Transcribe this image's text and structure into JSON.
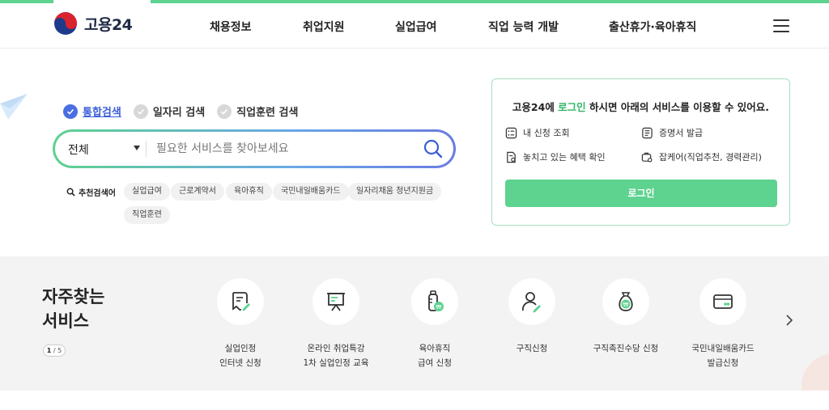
{
  "brand": {
    "name": "고용24"
  },
  "nav": {
    "items": [
      "채용정보",
      "취업지원",
      "실업급여",
      "직업 능력 개발",
      "출산휴가·육아휴직"
    ]
  },
  "search": {
    "tabs": [
      {
        "label": "통합검색",
        "active": true
      },
      {
        "label": "일자리 검색",
        "active": false
      },
      {
        "label": "직업훈련 검색",
        "active": false
      }
    ],
    "scope": "전체",
    "placeholder": "필요한 서비스를 찾아보세요",
    "value": "",
    "recommended_label": "추천검색어",
    "recommended": [
      "실업급여",
      "근로계약서",
      "육아휴직",
      "국민내일배움카드",
      "일자리채움 청년지원금",
      "직업훈련"
    ]
  },
  "login_card": {
    "msg_prefix": "고용24에 ",
    "msg_highlight": "로그인",
    "msg_suffix": " 하시면 아래의 서비스를 이용할 수 있어요.",
    "services": [
      "내 신청 조회",
      "증명서 발급",
      "놓치고 있는 혜택 확인",
      "잡케어(직업추천, 경력관리)"
    ],
    "button": "로그인"
  },
  "frequent": {
    "title_line1": "자주찾는",
    "title_line2": "서비스",
    "page_current": "1",
    "page_total": "/ 5",
    "items": [
      {
        "line1": "실업인정",
        "line2": "인터넷 신청",
        "icon": "document-pen-icon"
      },
      {
        "line1": "온라인 취업특강",
        "line2": "1차 실업인정 교육",
        "icon": "presentation-board-icon"
      },
      {
        "line1": "육아휴직",
        "line2": "급여 신청",
        "icon": "baby-bottle-won-icon"
      },
      {
        "line1": "구직신청",
        "line2": "",
        "icon": "person-pen-icon"
      },
      {
        "line1": "구직촉진수당 신청",
        "line2": "",
        "icon": "money-bag-won-icon"
      },
      {
        "line1": "국민내일배움카드",
        "line2": "발급신청",
        "icon": "card-icon"
      }
    ]
  },
  "colors": {
    "accent_green": "#5ed28f",
    "accent_blue": "#4a6fe0",
    "highlight_green": "#2fb565"
  }
}
